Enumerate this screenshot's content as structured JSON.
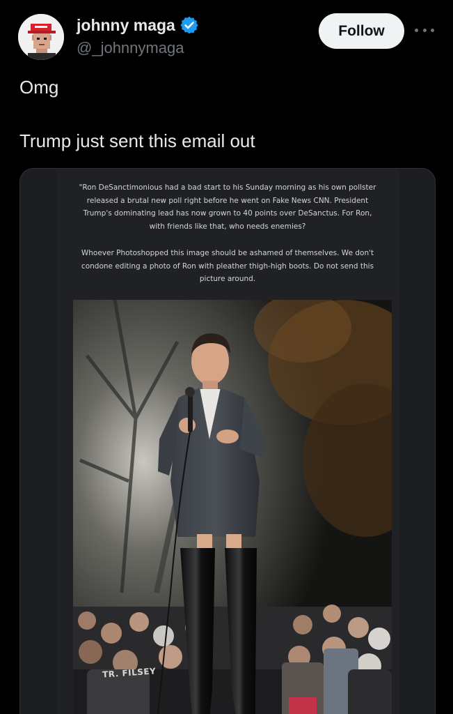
{
  "author": {
    "display_name": "johnny maga",
    "handle": "@_johnnymaga",
    "verified": true,
    "avatar_icon": "maga-hat-avatar-icon",
    "verified_icon": "verified-badge-icon",
    "verified_color": "#1d9bf0"
  },
  "actions": {
    "follow_label": "Follow",
    "more_icon": "more-dots-icon"
  },
  "tweet": {
    "line1": "Omg",
    "line2": "Trump just sent this email out"
  },
  "email": {
    "paragraph1": [
      "\"Ron DeSanctimonious had a bad start to his Sunday morning as his own pollster",
      "released a brutal new poll right before he went on Fake News CNN.  President",
      "Trump's dominating lead has now grown to 40 points over DeSanctus. For Ron,",
      "with friends like that, who needs enemies?"
    ],
    "paragraph2": [
      "Whoever Photoshopped this image should be ashamed of themselves. We don't",
      "condone editing a photo of Ron with pleather thigh-high boots. Do not send this",
      "picture around."
    ]
  },
  "photo": {
    "shirt_text": "TR. FILSEY"
  },
  "colors": {
    "background": "#000000",
    "text_primary": "#e7e9ea",
    "text_secondary": "#71767b",
    "follow_bg": "#eff3f4",
    "card_border": "#2f3336"
  }
}
